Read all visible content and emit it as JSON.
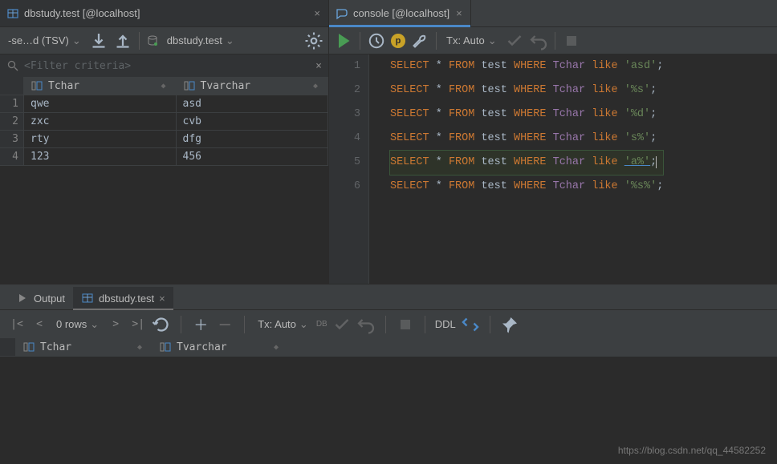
{
  "tabs": {
    "left": {
      "label": "dbstudy.test [@localhost]"
    },
    "right": {
      "label": "console [@localhost]"
    }
  },
  "left_toolbar": {
    "view_label": "-se…d (TSV)",
    "datasource_label": "dbstudy.test"
  },
  "right_toolbar": {
    "p_badge": "p",
    "tx_label": "Tx: Auto"
  },
  "filter": {
    "placeholder": "<Filter criteria>"
  },
  "columns": {
    "c1": "Tchar",
    "c2": "Tvarchar"
  },
  "rows": [
    {
      "n": "1",
      "c1": "qwe",
      "c2": "asd"
    },
    {
      "n": "2",
      "c1": "zxc",
      "c2": "cvb"
    },
    {
      "n": "3",
      "c1": "rty",
      "c2": "dfg"
    },
    {
      "n": "4",
      "c1": "123",
      "c2": "456"
    }
  ],
  "sql": {
    "SELECT": "SELECT",
    "FROM": "FROM",
    "WHERE": "WHERE",
    "like": "like",
    "star": "*",
    "test": "test",
    "Tchar": "Tchar",
    "semi": ";",
    "s1": "'asd'",
    "s2": "'%s'",
    "s3": "'%d'",
    "s4": "'s%'",
    "s5": "'a%'",
    "s6": "'%s%'"
  },
  "line_numbers": [
    "1",
    "2",
    "3",
    "4",
    "5",
    "6"
  ],
  "output_tabs": {
    "output": "Output",
    "grid": "dbstudy.test"
  },
  "bottom_bar": {
    "rows_label": "0 rows",
    "tx_label": "Tx: Auto",
    "ddl_label": "DDL",
    "db_label": "DB"
  },
  "bottom_columns": {
    "c1": "Tchar",
    "c2": "Tvarchar"
  },
  "watermark": "https://blog.csdn.net/qq_44582252"
}
